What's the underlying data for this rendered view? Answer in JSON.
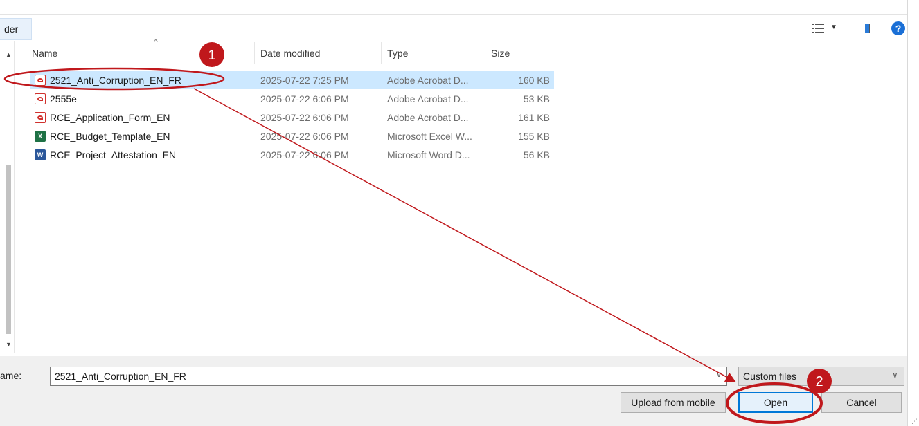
{
  "toolbar": {
    "folder_button_label": "der",
    "view_icon": "details-view-icon",
    "pane_icon": "preview-pane-icon",
    "help_label": "?"
  },
  "columns": {
    "name": "Name",
    "date": "Date modified",
    "type": "Type",
    "size": "Size"
  },
  "files": [
    {
      "name": "2521_Anti_Corruption_EN_FR",
      "date": "2025-07-22 7:25 PM",
      "type": "Adobe Acrobat D...",
      "size": "160 KB",
      "icon": "pdf-file-icon",
      "selected": true
    },
    {
      "name": "2555e",
      "date": "2025-07-22 6:06 PM",
      "type": "Adobe Acrobat D...",
      "size": "53 KB",
      "icon": "pdf-file-icon"
    },
    {
      "name": "RCE_Application_Form_EN",
      "date": "2025-07-22 6:06 PM",
      "type": "Adobe Acrobat D...",
      "size": "161 KB",
      "icon": "pdf-file-icon"
    },
    {
      "name": "RCE_Budget_Template_EN",
      "date": "2025-07-22 6:06 PM",
      "type": "Microsoft Excel W...",
      "size": "155 KB",
      "icon": "excel-file-icon"
    },
    {
      "name": "RCE_Project_Attestation_EN",
      "date": "2025-07-22 6:06 PM",
      "type": "Microsoft Word D...",
      "size": "56 KB",
      "icon": "word-file-icon"
    }
  ],
  "footer": {
    "name_label": "ame:",
    "name_value": "2521_Anti_Corruption_EN_FR",
    "filter_value": "Custom files",
    "upload_label": "Upload from mobile",
    "open_label": "Open",
    "cancel_label": "Cancel"
  },
  "annotations": {
    "marker_1": "1",
    "marker_2": "2",
    "color": "#c0181c"
  },
  "colors": {
    "selection": "#cce8ff",
    "accent": "#0078d7"
  }
}
